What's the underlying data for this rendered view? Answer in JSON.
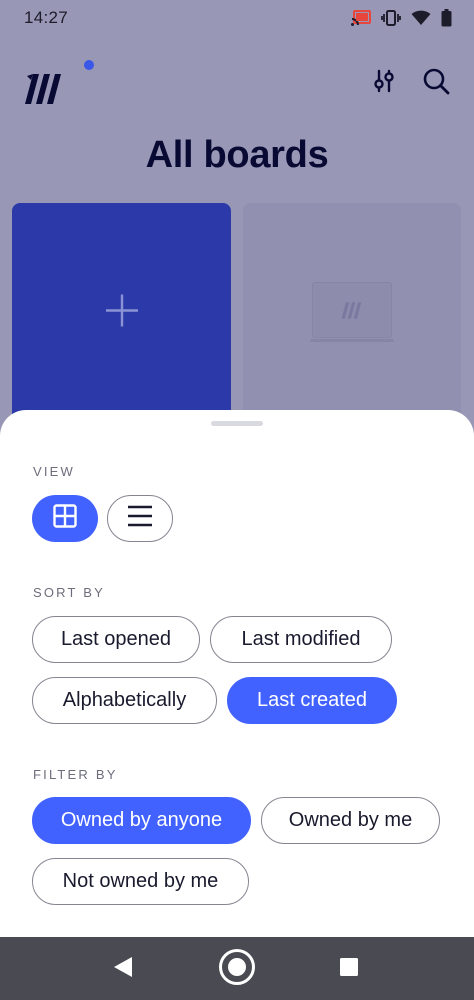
{
  "status_bar": {
    "time": "14:27",
    "icons": [
      "cast-icon",
      "vibrate-icon",
      "wifi-icon",
      "battery-icon"
    ]
  },
  "header": {
    "logo": "miro-logo",
    "actions": [
      "filter-sliders-icon",
      "search-icon"
    ]
  },
  "page": {
    "title": "All boards"
  },
  "boards": [
    {
      "type": "new-board",
      "icon": "plus-icon"
    },
    {
      "type": "board-thumbnail",
      "icon": "miro-board-preview"
    }
  ],
  "sheet": {
    "view": {
      "label": "VIEW",
      "options": [
        {
          "icon": "grid-icon",
          "selected": true
        },
        {
          "icon": "list-icon",
          "selected": false
        }
      ]
    },
    "sort": {
      "label": "SORT BY",
      "options": [
        {
          "label": "Last opened",
          "selected": false
        },
        {
          "label": "Last modified",
          "selected": false
        },
        {
          "label": "Alphabetically",
          "selected": false
        },
        {
          "label": "Last created",
          "selected": true
        }
      ]
    },
    "filter": {
      "label": "FILTER BY",
      "options": [
        {
          "label": "Owned by anyone",
          "selected": true
        },
        {
          "label": "Owned by me",
          "selected": false
        },
        {
          "label": "Not owned by me",
          "selected": false
        }
      ]
    }
  },
  "nav_bar": {
    "buttons": [
      "back-icon",
      "home-icon",
      "recents-icon"
    ]
  },
  "colors": {
    "accent": "#4262ff",
    "new_board": "#2b3aa8",
    "scrim": "#9997b6",
    "title": "#080a33",
    "nav_bar": "#4a4a52"
  }
}
